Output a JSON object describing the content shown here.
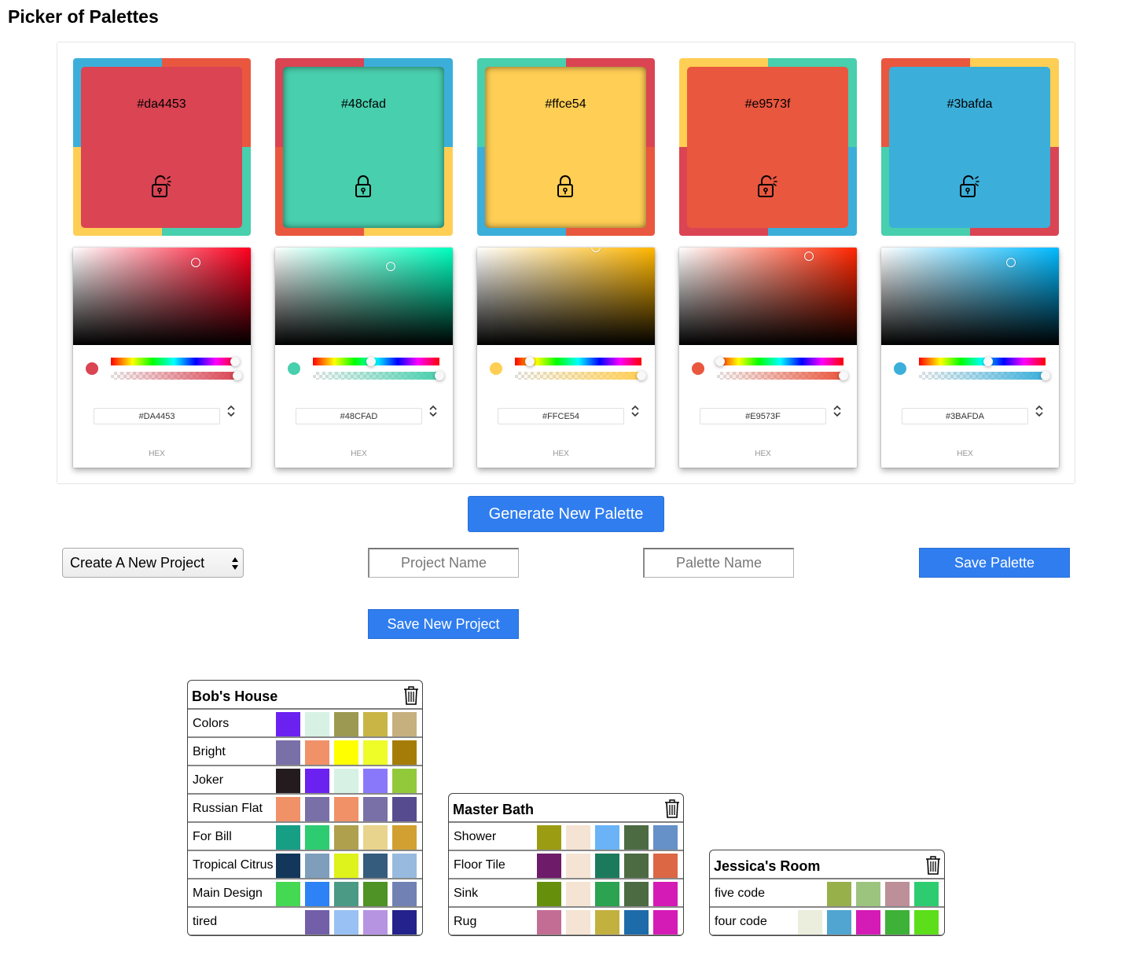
{
  "app": {
    "title": "Picker of Palettes"
  },
  "palette": [
    {
      "hex": "#da4453",
      "hex_upper": "#DA4453",
      "hex_caption": "HEX",
      "locked": false,
      "lock_icon": "lock-open-icon",
      "frame": {
        "tl": "#3bafda",
        "tr": "#e9573f",
        "bl": "#ffce54",
        "br": "#48cfad"
      },
      "hue": 0.98,
      "sat": 0.69,
      "val": 0.85
    },
    {
      "hex": "#48cfad",
      "hex_upper": "#48CFAD",
      "hex_caption": "HEX",
      "locked": true,
      "lock_icon": "lock-closed-icon",
      "frame": {
        "tl": "#da4453",
        "tr": "#3bafda",
        "bl": "#e9573f",
        "br": "#ffce54"
      },
      "hue": 0.458,
      "sat": 0.65,
      "val": 0.81
    },
    {
      "hex": "#ffce54",
      "hex_upper": "#FFCE54",
      "hex_caption": "HEX",
      "locked": true,
      "lock_icon": "lock-closed-icon",
      "frame": {
        "tl": "#48cfad",
        "tr": "#da4453",
        "bl": "#3bafda",
        "br": "#e9573f"
      },
      "hue": 0.119,
      "sat": 0.67,
      "val": 1.0
    },
    {
      "hex": "#e9573f",
      "hex_upper": "#E9573F",
      "hex_caption": "HEX",
      "locked": false,
      "lock_icon": "lock-open-icon",
      "frame": {
        "tl": "#ffce54",
        "tr": "#48cfad",
        "bl": "#da4453",
        "br": "#3bafda"
      },
      "hue": 0.024,
      "sat": 0.73,
      "val": 0.91
    },
    {
      "hex": "#3bafda",
      "hex_upper": "#3BAFDA",
      "hex_caption": "HEX",
      "locked": false,
      "lock_icon": "lock-open-icon",
      "frame": {
        "tl": "#e9573f",
        "tr": "#ffce54",
        "bl": "#48cfad",
        "br": "#da4453"
      },
      "hue": 0.545,
      "sat": 0.73,
      "val": 0.85
    }
  ],
  "controls": {
    "generate_label": "Generate New Palette",
    "project_select_value": "Create A New Project",
    "project_name_placeholder": "Project Name",
    "palette_name_placeholder": "Palette Name",
    "save_palette_label": "Save Palette",
    "save_project_label": "Save New Project"
  },
  "projects": [
    {
      "name": "Bob's House",
      "palettes": [
        {
          "name": "Colors",
          "colors": [
            "#6b22f0",
            "#d7f1e5",
            "#9c9a52",
            "#c8b545",
            "#c6b07e"
          ]
        },
        {
          "name": "Bright",
          "colors": [
            "#7a70a8",
            "#f09168",
            "#ffff00",
            "#eefc28",
            "#a67c08"
          ]
        },
        {
          "name": "Joker",
          "colors": [
            "#241b1e",
            "#6b22f0",
            "#d7f1e5",
            "#8a78fb",
            "#91c93a"
          ]
        },
        {
          "name": "Russian Flat",
          "colors": [
            "#f09168",
            "#7a70a8",
            "#f09168",
            "#7a70a8",
            "#574b90"
          ]
        },
        {
          "name": "For Bill",
          "colors": [
            "#179f86",
            "#2ecc71",
            "#aea04d",
            "#e8d48c",
            "#d2a030"
          ]
        },
        {
          "name": "Tropical Citrus",
          "colors": [
            "#12375b",
            "#7e9ebc",
            "#def21b",
            "#355c7d",
            "#98bade"
          ]
        },
        {
          "name": "Main Design",
          "colors": [
            "#45d852",
            "#2d83f5",
            "#4a9a85",
            "#4f9226",
            "#7281b4"
          ]
        },
        {
          "name": "tired",
          "colors": [
            "#735fa8",
            "#99c1f3",
            "#b794e2",
            "#24238c"
          ]
        }
      ]
    },
    {
      "name": "Master Bath",
      "palettes": [
        {
          "name": "Shower",
          "colors": [
            "#9c9c12",
            "#f5e4d3",
            "#6ab3f6",
            "#4d6b43",
            "#6590c8"
          ]
        },
        {
          "name": "Floor Tile",
          "colors": [
            "#6e1b69",
            "#f5e4d3",
            "#1c7a5c",
            "#4d6b43",
            "#db6745"
          ]
        },
        {
          "name": "Sink",
          "colors": [
            "#66900c",
            "#f5e4d3",
            "#2ba350",
            "#4d6b43",
            "#d51bb5"
          ]
        },
        {
          "name": "Rug",
          "colors": [
            "#c46d94",
            "#f5e4d3",
            "#c3b13f",
            "#1e6baa",
            "#d51bb5"
          ]
        }
      ]
    },
    {
      "name": "Jessica's Room",
      "palettes": [
        {
          "name": "five code",
          "colors": [
            "#98b04a",
            "#9cc47f",
            "#bd8f98",
            "#2ecc71"
          ]
        },
        {
          "name": "four code",
          "colors": [
            "#ebeedd",
            "#50a5d1",
            "#d51bb5",
            "#3eb138",
            "#5cde1b"
          ]
        }
      ]
    }
  ]
}
